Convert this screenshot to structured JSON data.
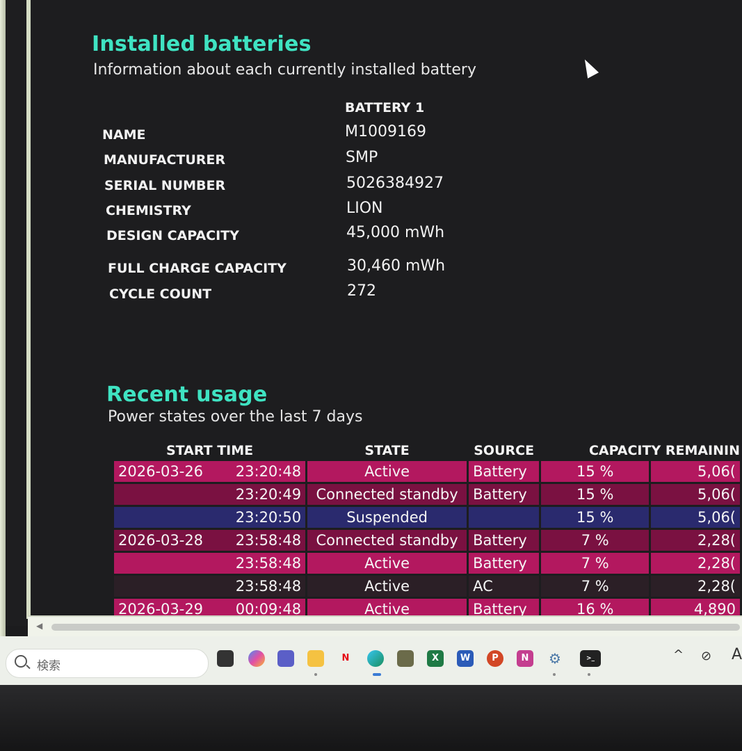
{
  "installed": {
    "title": "Installed batteries",
    "subtitle": "Information about each currently installed battery",
    "column_header": "BATTERY 1",
    "rows": [
      {
        "label": "NAME",
        "value": "M1009169"
      },
      {
        "label": "MANUFACTURER",
        "value": "SMP"
      },
      {
        "label": "SERIAL NUMBER",
        "value": "5026384927"
      },
      {
        "label": "CHEMISTRY",
        "value": "LION"
      },
      {
        "label": "DESIGN CAPACITY",
        "value": "45,000 mWh"
      },
      {
        "label": "FULL CHARGE CAPACITY",
        "value": "30,460 mWh"
      },
      {
        "label": "CYCLE COUNT",
        "value": "272"
      }
    ]
  },
  "recent": {
    "title": "Recent usage",
    "subtitle": "Power states over the last 7 days",
    "headers": [
      "START TIME",
      "STATE",
      "SOURCE",
      "CAPACITY REMAININ"
    ],
    "rows": [
      {
        "date": "2026-03-26",
        "time": "23:20:48",
        "state": "Active",
        "source": "Battery",
        "pct": "15 %",
        "cap": "5,06(",
        "style": "mag"
      },
      {
        "date": "",
        "time": "23:20:49",
        "state": "Connected standby",
        "source": "Battery",
        "pct": "15 %",
        "cap": "5,06(",
        "style": "dmag"
      },
      {
        "date": "",
        "time": "23:20:50",
        "state": "Suspended",
        "source": "",
        "pct": "15 %",
        "cap": "5,06(",
        "style": "blue"
      },
      {
        "date": "2026-03-28",
        "time": "23:58:48",
        "state": "Connected standby",
        "source": "Battery",
        "pct": "7 %",
        "cap": "2,28(",
        "style": "dmag"
      },
      {
        "date": "",
        "time": "23:58:48",
        "state": "Active",
        "source": "Battery",
        "pct": "7 %",
        "cap": "2,28(",
        "style": "mag"
      },
      {
        "date": "",
        "time": "23:58:48",
        "state": "Active",
        "source": "AC",
        "pct": "7 %",
        "cap": "2,28(",
        "style": "dark"
      },
      {
        "date": "2026-03-29",
        "time": "00:09:48",
        "state": "Active",
        "source": "Battery",
        "pct": "16 %",
        "cap": "4,890",
        "style": "mag"
      }
    ]
  },
  "taskbar": {
    "search_placeholder": "検索",
    "icons": [
      "file-explorer-icon",
      "copilot-icon",
      "teams-icon",
      "folder-icon",
      "netflix-icon",
      "edge-icon",
      "app-icon",
      "excel-icon",
      "word-icon",
      "powerpoint-icon",
      "onenote-icon",
      "settings-icon",
      "terminal-icon"
    ],
    "tray": {
      "chevron": "^",
      "letter": "A"
    },
    "colors": {
      "magenta": "#b3185f",
      "dark_magenta": "#7a1141",
      "blue": "#2a2a6e",
      "heading": "#3fe3c2"
    }
  }
}
